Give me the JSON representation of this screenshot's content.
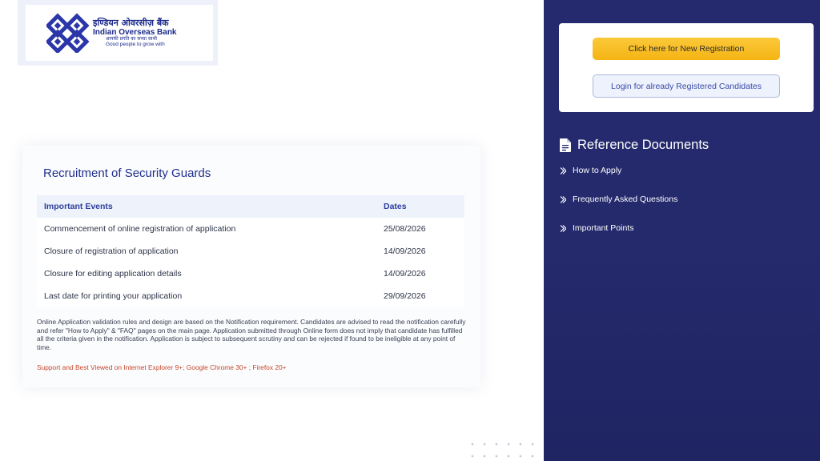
{
  "logo": {
    "hindi": "इण्डियन ओवरसीज़ बैंक",
    "english": "Indian Overseas Bank",
    "tagline_hindi": "आपकी प्रगति का सच्चा साथी",
    "tagline_english": "Good people to grow with"
  },
  "main": {
    "title": "Recruitment of Security Guards",
    "table": {
      "headers": [
        "Important Events",
        "Dates"
      ],
      "rows": [
        [
          "Commencement of online registration of application",
          "25/08/2026"
        ],
        [
          "Closure of registration of application",
          "14/09/2026"
        ],
        [
          "Closure for editing application details",
          "14/09/2026"
        ],
        [
          "Last date for printing your application",
          "29/09/2026"
        ]
      ]
    },
    "note": "Online Application validation rules and design are based on the Notification requirement. Candidates are advised to read the notification carefully and refer \"How to Apply\" & \"FAQ\" pages on the main page. Application submitted through Online form does not imply that candidate has fulfilled all the criteria given in the notification. Application is subject to subsequent scrutiny and can be rejected if found to be ineligible at any point of time.",
    "support": "Support and Best Viewed on Internet Explorer 9+; Google Chrome 30+ ; Firefox 20+"
  },
  "sidebar": {
    "new_registration": "Click here for New Registration",
    "login": "Login for already Registered Candidates",
    "reference_title": "Reference Documents",
    "items": [
      {
        "label": "How to Apply"
      },
      {
        "label": "Frequently Asked Questions"
      },
      {
        "label": "Important Points"
      }
    ]
  },
  "colors": {
    "panel": "#242a6c",
    "accent_yellow": "#f5b414",
    "title_blue": "#1f2f8e",
    "support_red": "#c6472a"
  }
}
